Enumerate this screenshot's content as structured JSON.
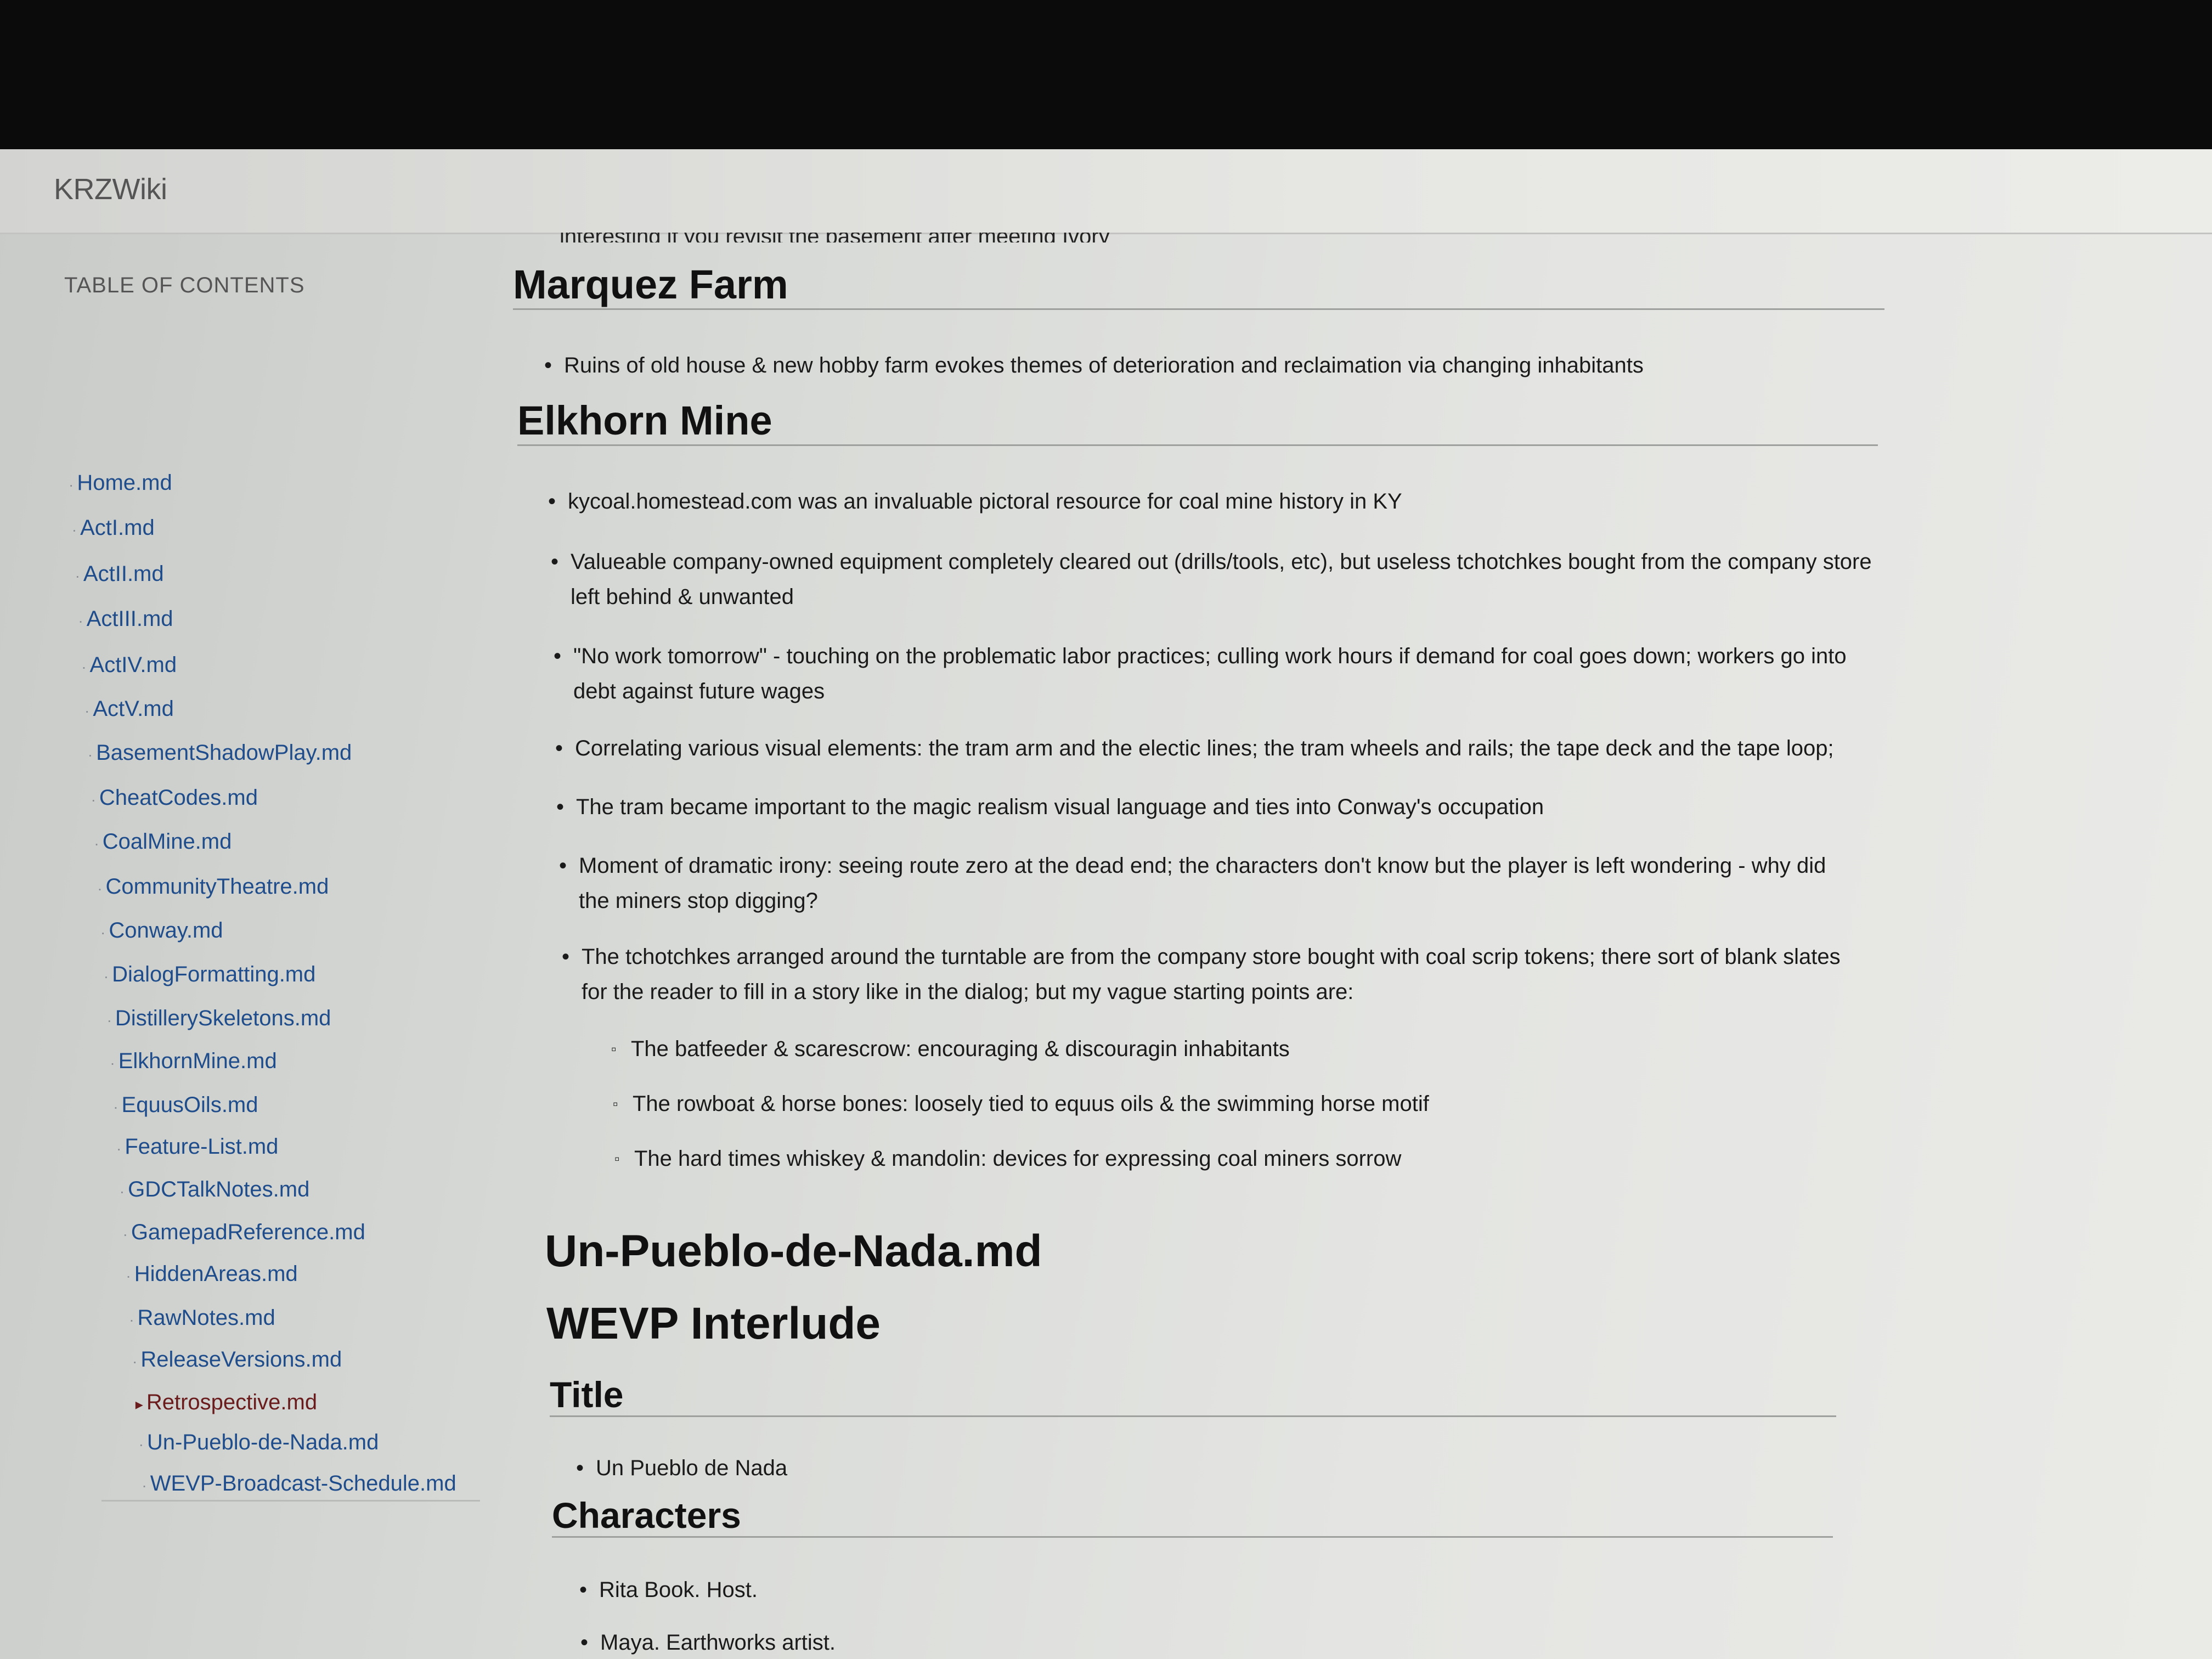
{
  "app": {
    "brand": "KRZWiki"
  },
  "toc": {
    "heading": "TABLE OF CONTENTS",
    "items": [
      "Home.md",
      "ActI.md",
      "ActII.md",
      "ActIII.md",
      "ActIV.md",
      "ActV.md",
      "BasementShadowPlay.md",
      "CheatCodes.md",
      "CoalMine.md",
      "CommunityTheatre.md",
      "Conway.md",
      "DialogFormatting.md",
      "DistillerySkeletons.md",
      "ElkhornMine.md",
      "EquusOils.md",
      "Feature-List.md",
      "GDCTalkNotes.md",
      "GamepadReference.md",
      "HiddenAreas.md",
      "RawNotes.md",
      "ReleaseVersions.md",
      "Retrospective.md",
      "Un-Pueblo-de-Nada.md",
      "WEVP-Broadcast-Schedule.md"
    ],
    "active_index": 21
  },
  "content": {
    "cut_line": "interesting if you revisit the basement after meeting Ivory",
    "marquez": {
      "title": "Marquez Farm",
      "bullets": [
        "Ruins of old house & new hobby farm evokes themes of deterioration and reclaimation via changing inhabitants"
      ]
    },
    "elkhorn": {
      "title": "Elkhorn Mine",
      "bullets": [
        "kycoal.homestead.com was an invaluable pictoral resource for coal mine history in KY",
        "Valueable company-owned equipment completely cleared out (drills/tools, etc), but useless tchotchkes bought from the company store left behind & unwanted",
        "\"No work tomorrow\" - touching on the problematic labor practices; culling work hours if demand for coal goes down; workers go into debt against future wages",
        "Correlating various visual elements: the tram arm and the electic lines; the tram wheels and rails; the tape deck and the tape loop;",
        "The tram became important to the magic realism visual language and ties into Conway's occupation",
        "Moment of dramatic irony: seeing route zero at the dead end; the characters don't know but the player is left wondering - why did the miners stop digging?",
        "The tchotchkes arranged around the turntable are from the company store bought with coal scrip tokens; there sort of blank slates for the reader to fill in a story like in the dialog; but my vague starting points are:"
      ],
      "sub_bullets": [
        "The batfeeder & scarescrow: encouraging & discouragin inhabitants",
        "The rowboat & horse bones: loosely tied to equus oils & the swimming horse motif",
        "The hard times whiskey & mandolin: devices for expressing coal miners sorrow"
      ]
    },
    "doc_title": "Un-Pueblo-de-Nada.md",
    "interlude_title": "WEVP Interlude",
    "title_section": {
      "heading": "Title",
      "bullets": [
        "Un Pueblo de Nada"
      ]
    },
    "characters_section": {
      "heading": "Characters",
      "bullets": [
        "Rita Book. Host.",
        "Maya. Earthworks artist."
      ]
    }
  }
}
